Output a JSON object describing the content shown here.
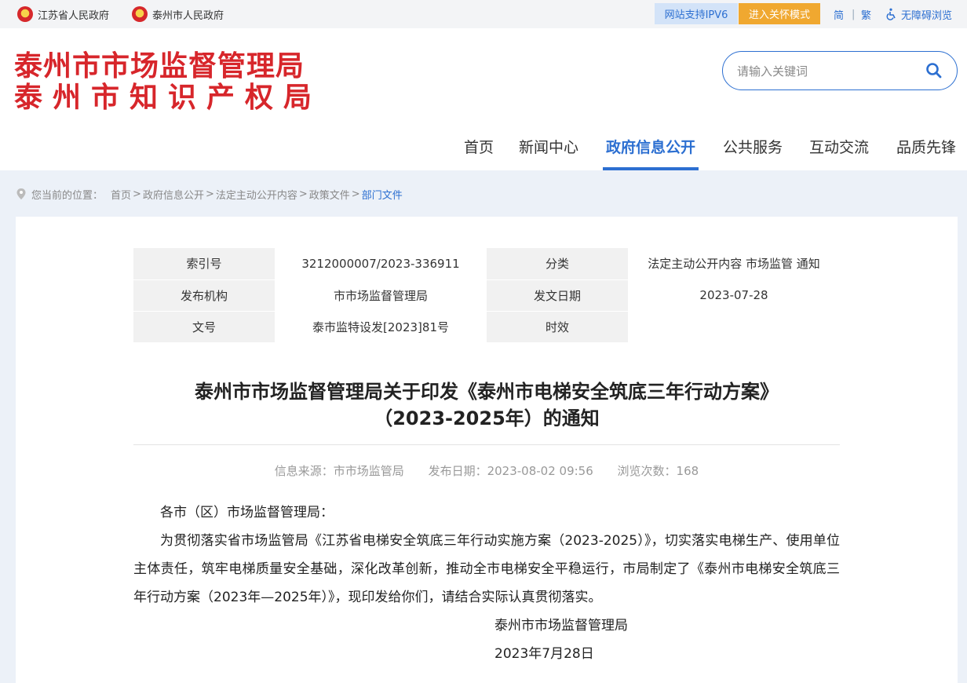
{
  "topbar": {
    "provincial_gov": "江苏省人民政府",
    "city_gov": "泰州市人民政府",
    "ipv6": "网站支持IPV6",
    "care_mode": "进入关怀模式",
    "simplified": "简",
    "separator": "|",
    "traditional": "繁",
    "accessibility": "无障碍浏览"
  },
  "header": {
    "logo_line1": "泰州市市场监督管理局",
    "logo_line2": "泰州市知识产权局",
    "search_placeholder": "请输入关键词"
  },
  "nav": {
    "items": [
      "首页",
      "新闻中心",
      "政府信息公开",
      "公共服务",
      "互动交流",
      "品质先锋"
    ],
    "active": "政府信息公开"
  },
  "breadcrumb": {
    "prefix": "您当前的位置：",
    "items": [
      "首页",
      "政府信息公开",
      "法定主动公开内容",
      "政策文件",
      "部门文件"
    ]
  },
  "meta": {
    "index_label": "索引号",
    "index_value": "3212000007/2023-336911",
    "category_label": "分类",
    "category_value": "法定主动公开内容 市场监管 通知",
    "issuer_label": "发布机构",
    "issuer_value": "市市场监督管理局",
    "date_label": "发文日期",
    "date_value": "2023-07-28",
    "docno_label": "文号",
    "docno_value": "泰市监特设发[2023]81号",
    "validity_label": "时效",
    "validity_value": ""
  },
  "article": {
    "title_line1": "泰州市市场监督管理局关于印发《泰州市电梯安全筑底三年行动方案》",
    "title_line2": "（2023-2025年）的通知",
    "source": "信息来源：市市场监管局",
    "published": "发布日期：2023-08-02 09:56",
    "views": "浏览次数：168",
    "salutation": "各市（区）市场监督管理局：",
    "paragraph": "为贯彻落实省市场监管局《江苏省电梯安全筑底三年行动实施方案（2023-2025）》，切实落实电梯生产、使用单位主体责任，筑牢电梯质量安全基础，深化改革创新，推动全市电梯安全平稳运行，市局制定了《泰州市电梯安全筑底三年行动方案（2023年—2025年）》，现印发给你们，请结合实际认真贯彻落实。",
    "signature": "泰州市市场监督管理局",
    "sign_date": "2023年7月28日"
  }
}
